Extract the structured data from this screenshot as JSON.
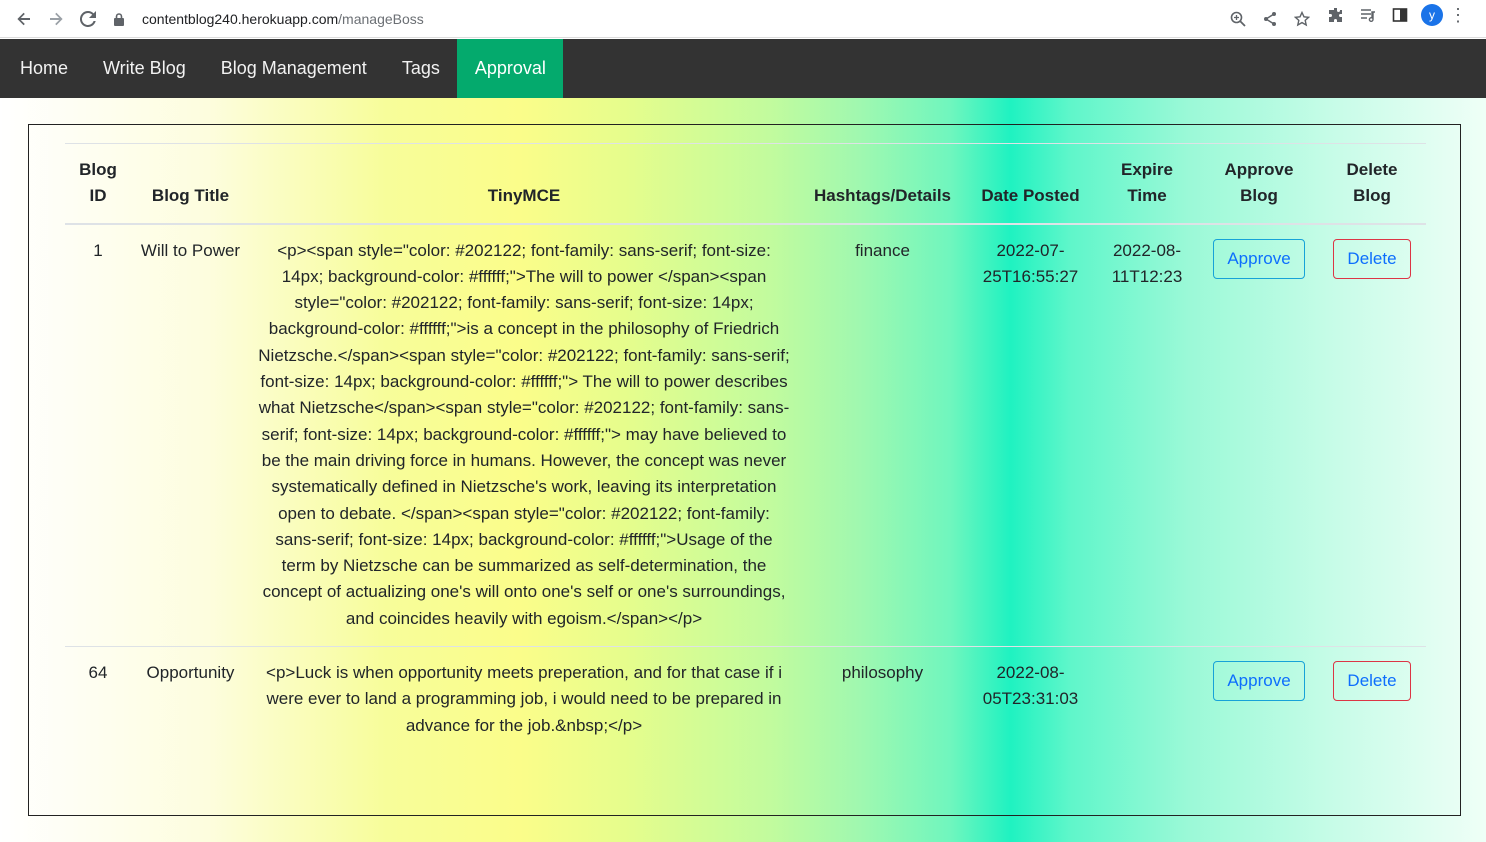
{
  "browser": {
    "url_host": "contentblog240.herokuapp.com",
    "url_path": "/manageBoss",
    "avatar_letter": "y"
  },
  "nav": {
    "items": [
      {
        "label": "Home"
      },
      {
        "label": "Write Blog"
      },
      {
        "label": "Blog Management"
      },
      {
        "label": "Tags"
      },
      {
        "label": "Approval"
      }
    ],
    "active": "Approval",
    "active_color": "#04AA6D",
    "bar_color": "#333333"
  },
  "table": {
    "headers": {
      "id": "Blog ID",
      "title": "Blog Title",
      "tiny": "TinyMCE",
      "tags": "Hashtags/Details",
      "date": "Date Posted",
      "expire": "Expire Time",
      "approve": "Approve Blog",
      "delete": "Delete Blog"
    },
    "rows": [
      {
        "id": "1",
        "title": "Will to Power",
        "tiny": "<p><span style=\"color: #202122; font-family: sans-serif; font-size: 14px; background-color: #ffffff;\">The will to power </span><span style=\"color: #202122; font-family: sans-serif; font-size: 14px; background-color: #ffffff;\">is a concept in the philosophy of Friedrich Nietzsche.</span><span style=\"color: #202122; font-family: sans-serif; font-size: 14px; background-color: #ffffff;\"> The will to power describes what Nietzsche</span><span style=\"color: #202122; font-family: sans-serif; font-size: 14px; background-color: #ffffff;\"> may have believed to be the main driving force in humans. However, the concept was never systematically defined in Nietzsche's work, leaving its interpretation open to debate. </span><span style=\"color: #202122; font-family: sans-serif; font-size: 14px; background-color: #ffffff;\">Usage of the term by Nietzsche can be summarized as self-determination, the concept of actualizing one's will onto one's self or one's surroundings, and coincides heavily with egoism.</span></p>",
        "tags": "finance",
        "date": "2022-07-25T16:55:27",
        "expire": "2022-08-11T12:23",
        "approve_label": "Approve",
        "delete_label": "Delete"
      },
      {
        "id": "64",
        "title": "Opportunity",
        "tiny": "<p>Luck is when opportunity meets preperation, and for that case if i were ever to land a programming job, i would need to be prepared in advance for the job.&nbsp;</p>",
        "tags": "philosophy",
        "date": "2022-08-05T23:31:03",
        "expire": "",
        "approve_label": "Approve",
        "delete_label": "Delete"
      }
    ]
  },
  "colors": {
    "approve_border": "#17a2d8",
    "delete_border": "#dc3545",
    "button_text": "#0d6efd"
  }
}
